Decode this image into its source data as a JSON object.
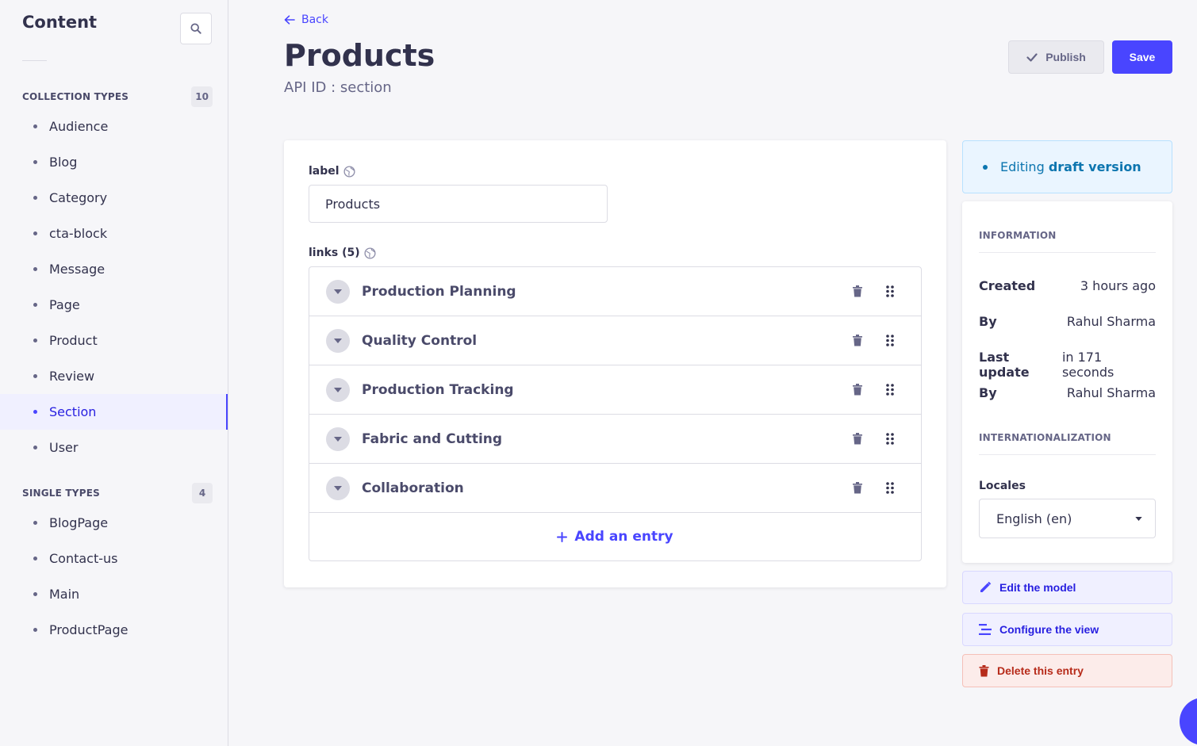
{
  "sidebar": {
    "title": "Content",
    "collection_types": {
      "label": "COLLECTION TYPES",
      "count": "10",
      "items": [
        {
          "label": "Audience"
        },
        {
          "label": "Blog"
        },
        {
          "label": "Category"
        },
        {
          "label": "cta-block"
        },
        {
          "label": "Message"
        },
        {
          "label": "Page"
        },
        {
          "label": "Product"
        },
        {
          "label": "Review"
        },
        {
          "label": "Section",
          "active": true
        },
        {
          "label": "User"
        }
      ]
    },
    "single_types": {
      "label": "SINGLE TYPES",
      "count": "4",
      "items": [
        {
          "label": "BlogPage"
        },
        {
          "label": "Contact-us"
        },
        {
          "label": "Main"
        },
        {
          "label": "ProductPage"
        }
      ]
    }
  },
  "header": {
    "back_label": "Back",
    "title": "Products",
    "api_id": "API ID : section",
    "publish_label": "Publish",
    "save_label": "Save"
  },
  "form": {
    "label_field": {
      "label": "label",
      "value": "Products"
    },
    "links": {
      "label": "links (5)",
      "items": [
        {
          "name": "Production Planning"
        },
        {
          "name": "Quality Control"
        },
        {
          "name": "Production Tracking"
        },
        {
          "name": "Fabric and Cutting"
        },
        {
          "name": "Collaboration"
        }
      ],
      "add_label": "Add an entry"
    }
  },
  "panel": {
    "draft_prefix": "Editing ",
    "draft_strong": "draft version",
    "information_heading": "INFORMATION",
    "created_key": "Created",
    "created_value": "3 hours ago",
    "by_key": "By",
    "created_by": "Rahul Sharma",
    "updated_key": "Last update",
    "updated_value": "in 171 seconds",
    "updated_by": "Rahul Sharma",
    "i18n_heading": "INTERNATIONALIZATION",
    "locales_label": "Locales",
    "locale_value": "English (en)",
    "edit_model": "Edit the model",
    "configure_view": "Configure the view",
    "delete_entry": "Delete this entry"
  },
  "colors": {
    "primary": "#4945ff",
    "danger": "#b72b1a",
    "info": "#0c75af"
  }
}
